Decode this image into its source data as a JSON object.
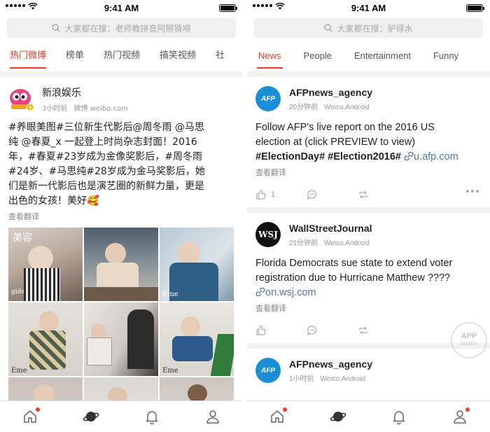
{
  "status": {
    "time": "9:41 AM"
  },
  "left": {
    "search_placeholder": "大家都在搜：老师教拼音阿掰猜嘚",
    "tabs": [
      "热门微博",
      "榜单",
      "热门视频",
      "搞笑视频",
      "社"
    ],
    "post": {
      "username": "新浪娱乐",
      "time": "3小时前",
      "source": "微博 weibo.com",
      "content_line1": "#养眼美图#三位新生代影后@周冬雨 @马思",
      "content_line2": "纯 @春夏_x 一起登上时尚杂志封面！2016",
      "content_line3": "年，#春夏#23岁成为金像奖影后，#周冬雨",
      "content_line4": "#24岁、#马思纯#28岁成为金马奖影后，她",
      "content_line5": "们是新一代影后也是演艺圈的新鲜力量，更是",
      "content_line6": "出色的女孩！美好🥰",
      "translate": "查看翻译",
      "photo_captions": [
        "美容",
        "gids rising",
        "",
        "Eme",
        "Eme",
        "",
        "Eme",
        "Eme",
        "",
        ""
      ]
    }
  },
  "right": {
    "search_placeholder": "大家都在搜：驴得水",
    "tabs": [
      "News",
      "People",
      "Entertainment",
      "Funny"
    ],
    "posts": [
      {
        "username": "AFPnews_agency",
        "time": "20分钟前",
        "source": "Weico.Android",
        "avatar_text": "AFP",
        "line1": "Follow AFP's live report on the 2016 US",
        "line2": "election at (click PREVIEW to view)",
        "tag1": "#ElectionDay#",
        "tag2": "#Election2016#",
        "link": "u.afp.com",
        "translate": "查看翻译",
        "like_count": "1"
      },
      {
        "username": "WallStreetJournal",
        "time": "21分钟前",
        "source": "Weico.Android",
        "avatar_text": "WSJ",
        "line1": "Florida Democrats sue state to extend voter",
        "line2": "registration due to Hurricane Matthew ????",
        "link": "on.wsj.com",
        "translate": "查看翻译"
      },
      {
        "username": "AFPnews_agency",
        "time": "1小时前",
        "source": "Weico.Android",
        "avatar_text": "AFP"
      }
    ],
    "watermark_top": "APP",
    "watermark_bottom": "solution"
  },
  "colors": {
    "accent": "#e8392b",
    "link": "#5079a8",
    "afp_blue": "#1b8fd6"
  }
}
